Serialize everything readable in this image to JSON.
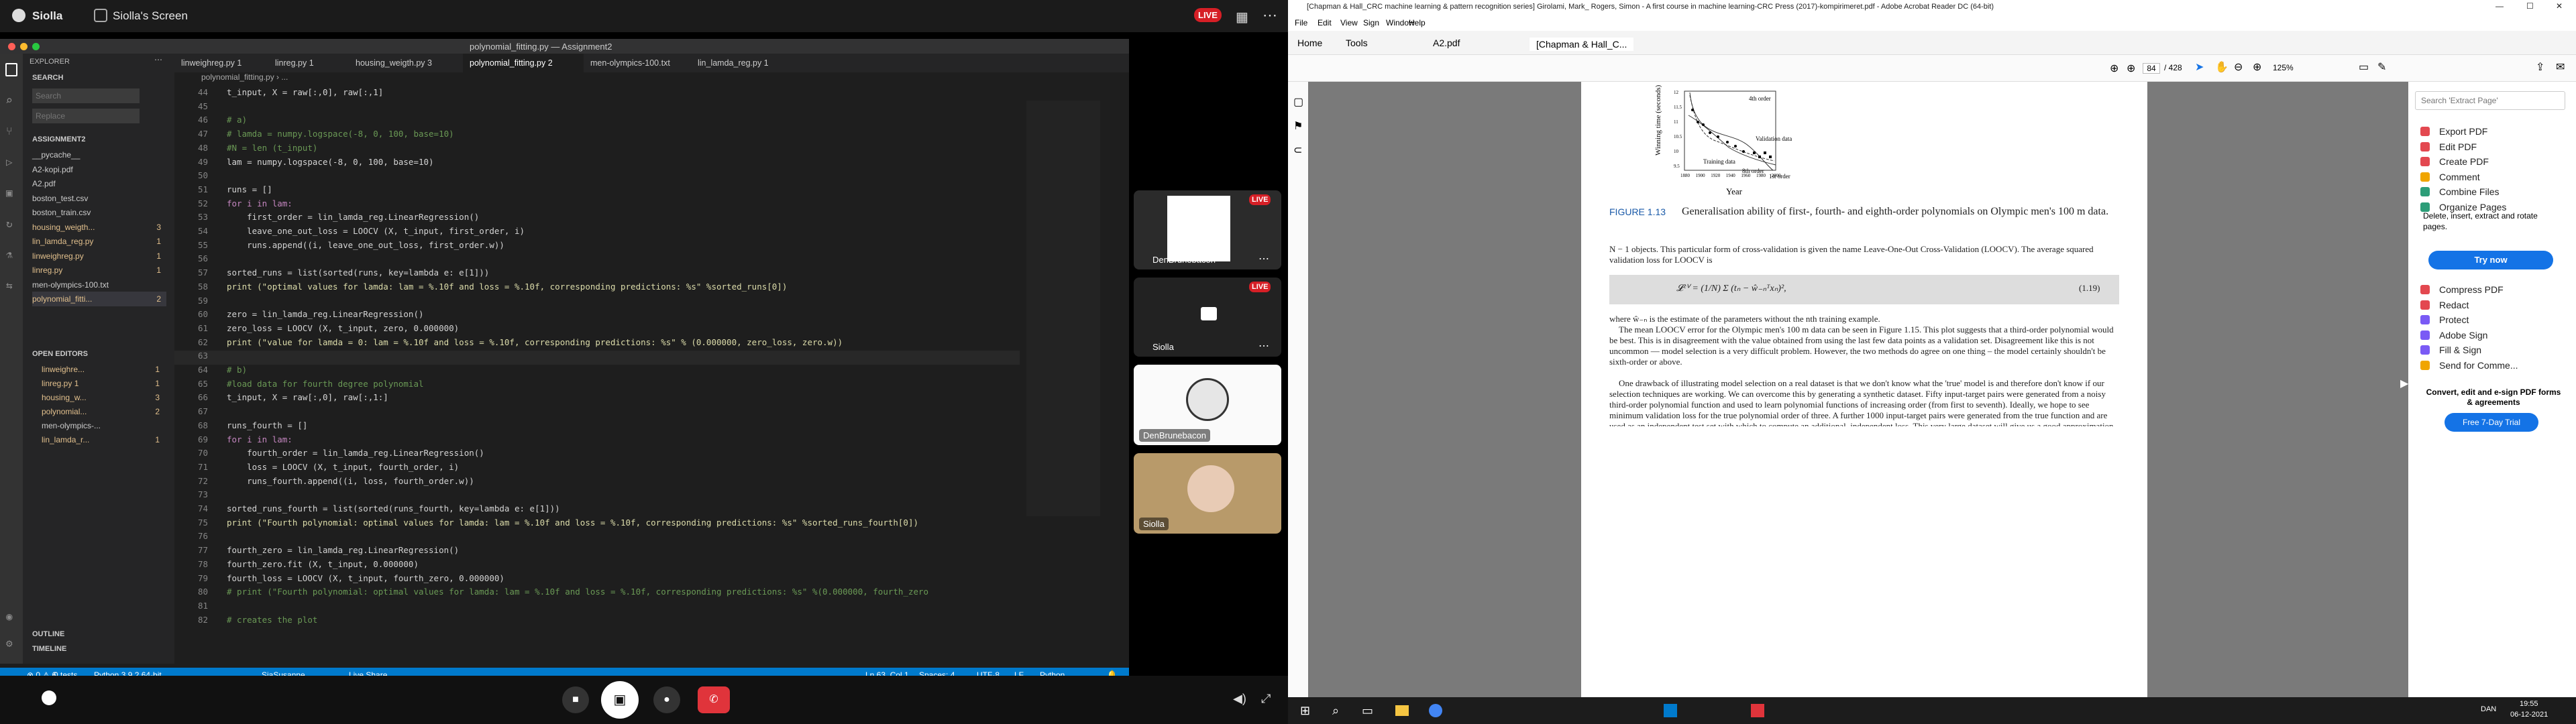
{
  "share": {
    "name": "Siolla",
    "screen": "Siolla's Screen",
    "live": "LIVE"
  },
  "vscode": {
    "title": "polynomial_fitting.py — Assignment2",
    "tabs": [
      {
        "label": "linweighreg.py 1"
      },
      {
        "label": "linreg.py 1"
      },
      {
        "label": "housing_weigth.py 3"
      },
      {
        "label": "polynomial_fitting.py 2"
      },
      {
        "label": "men-olympics-100.txt"
      },
      {
        "label": "lin_lamda_reg.py 1"
      }
    ],
    "breadcrumb": "polynomial_fitting.py › ...",
    "explorer": {
      "title": "EXPLORER",
      "search_title": "SEARCH",
      "search_placeholder": "Search",
      "replace_placeholder": "Replace",
      "folder": "ASSIGNMENT2",
      "files": [
        {
          "name": "__pycache__",
          "badge": ""
        },
        {
          "name": "A2-kopi.pdf",
          "badge": ""
        },
        {
          "name": "A2.pdf",
          "badge": ""
        },
        {
          "name": "boston_test.csv",
          "badge": ""
        },
        {
          "name": "boston_train.csv",
          "badge": ""
        },
        {
          "name": "housing_weigth...",
          "badge": "3"
        },
        {
          "name": "lin_lamda_reg.py",
          "badge": "1"
        },
        {
          "name": "linweighreg.py",
          "badge": "1"
        },
        {
          "name": "linreg.py",
          "badge": "1"
        },
        {
          "name": "men-olympics-100.txt",
          "badge": ""
        },
        {
          "name": "polynomial_fitti...",
          "badge": "2"
        }
      ],
      "open_editors_title": "OPEN EDITORS",
      "open_editors": [
        {
          "name": "linweighre...",
          "badge": "1"
        },
        {
          "name": "linreg.py 1",
          "badge": "1"
        },
        {
          "name": "housing_w...",
          "badge": "3"
        },
        {
          "name": "polynomial...",
          "badge": "2"
        },
        {
          "name": "men-olympics-...",
          "badge": ""
        },
        {
          "name": "lin_lamda_r...",
          "badge": "1"
        }
      ],
      "outline": "OUTLINE",
      "timeline": "TIMELINE"
    },
    "code": [
      {
        "n": "44",
        "t": "t_input, X = raw[:,0], raw[:,1]"
      },
      {
        "n": "45",
        "t": ""
      },
      {
        "n": "46",
        "t": "# a)"
      },
      {
        "n": "47",
        "t": "# lamda = numpy.logspace(-8, 0, 100, base=10)"
      },
      {
        "n": "48",
        "t": "#N = len (t_input)"
      },
      {
        "n": "49",
        "t": "lam = numpy.logspace(-8, 0, 100, base=10)"
      },
      {
        "n": "50",
        "t": ""
      },
      {
        "n": "51",
        "t": "runs = []"
      },
      {
        "n": "52",
        "t": "for i in lam:"
      },
      {
        "n": "53",
        "t": "    first_order = lin_lamda_reg.LinearRegression()"
      },
      {
        "n": "54",
        "t": "    leave_one_out_loss = LOOCV (X, t_input, first_order, i)"
      },
      {
        "n": "55",
        "t": "    runs.append((i, leave_one_out_loss, first_order.w))"
      },
      {
        "n": "56",
        "t": ""
      },
      {
        "n": "57",
        "t": "sorted_runs = list(sorted(runs, key=lambda e: e[1]))"
      },
      {
        "n": "58",
        "t": "print (\"optimal values for lamda: lam = %.10f and loss = %.10f, corresponding predictions: %s\" %sorted_runs[0])"
      },
      {
        "n": "59",
        "t": ""
      },
      {
        "n": "60",
        "t": "zero = lin_lamda_reg.LinearRegression()"
      },
      {
        "n": "61",
        "t": "zero_loss = LOOCV (X, t_input, zero, 0.000000)"
      },
      {
        "n": "62",
        "t": "print (\"value for lamda = 0: lam = %.10f and loss = %.10f, corresponding predictions: %s\" % (0.000000, zero_loss, zero.w))"
      },
      {
        "n": "63",
        "t": ""
      },
      {
        "n": "64",
        "t": "# b)"
      },
      {
        "n": "65",
        "t": "#load data for fourth degree polynomial"
      },
      {
        "n": "66",
        "t": "t_input, X = raw[:,0], raw[:,1:]"
      },
      {
        "n": "67",
        "t": ""
      },
      {
        "n": "68",
        "t": "runs_fourth = []"
      },
      {
        "n": "69",
        "t": "for i in lam:"
      },
      {
        "n": "70",
        "t": "    fourth_order = lin_lamda_reg.LinearRegression()"
      },
      {
        "n": "71",
        "t": "    loss = LOOCV (X, t_input, fourth_order, i)"
      },
      {
        "n": "72",
        "t": "    runs_fourth.append((i, loss, fourth_order.w))"
      },
      {
        "n": "73",
        "t": ""
      },
      {
        "n": "74",
        "t": "sorted_runs_fourth = list(sorted(runs_fourth, key=lambda e: e[1]))"
      },
      {
        "n": "75",
        "t": "print (\"Fourth polynomial: optimal values for lamda: lam = %.10f and loss = %.10f, corresponding predictions: %s\" %sorted_runs_fourth[0])"
      },
      {
        "n": "76",
        "t": ""
      },
      {
        "n": "77",
        "t": "fourth_zero = lin_lamda_reg.LinearRegression()"
      },
      {
        "n": "78",
        "t": "fourth_zero.fit (X, t_input, 0.000000)"
      },
      {
        "n": "79",
        "t": "fourth_loss = LOOCV (X, t_input, fourth_zero, 0.000000)"
      },
      {
        "n": "80",
        "t": "# print (\"Fourth polynomial: optimal values for lamda: lam = %.10f and loss = %.10f, corresponding predictions: %s\" %(0.000000, fourth_zero"
      },
      {
        "n": "81",
        "t": ""
      },
      {
        "n": "82",
        "t": "# creates the plot"
      }
    ],
    "status": {
      "errors": "⊗ 0 ⚠ 6",
      "tests": "0 tests",
      "python": "Python 3.9.2 64-bit",
      "live": "SiaSusanne",
      "liveshare": "Live Share",
      "pos": "Ln 63, Col 1",
      "spaces": "Spaces: 4",
      "enc": "UTF-8",
      "eol": "LF",
      "lang": "Python"
    }
  },
  "participants": [
    {
      "name": "DenBrunebacon",
      "live": "LIVE"
    },
    {
      "name": "Siolla",
      "live": "LIVE"
    },
    {
      "name": "DenBrunebacon"
    },
    {
      "name": "Siolla"
    }
  ],
  "acrobat": {
    "title": "[Chapman & Hall_CRC machine learning & pattern recognition series] Girolami, Mark_ Rogers, Simon - A first course in machine learning-CRC Press (2017)-kompirimeret.pdf - Adobe Acrobat Reader DC (64-bit)",
    "menu": [
      "File",
      "Edit",
      "View",
      "Sign",
      "Window",
      "Help"
    ],
    "tabs": [
      "Home",
      "Tools",
      "A2.pdf",
      "[Chapman & Hall_C..."
    ],
    "page_num": "84",
    "page_total": "/ 428",
    "zoom": "125%",
    "search_placeholder": "Search 'Extract Page'",
    "tools": [
      {
        "label": "Export PDF",
        "color": "#e34850"
      },
      {
        "label": "Edit PDF",
        "color": "#e34850"
      },
      {
        "label": "Create PDF",
        "color": "#e34850"
      },
      {
        "label": "Comment",
        "color": "#f0a500"
      },
      {
        "label": "Combine Files",
        "color": "#2d9d78"
      },
      {
        "label": "Organize Pages",
        "color": "#2d9d78"
      }
    ],
    "organize_desc": "Delete, insert, extract and rotate pages.",
    "try_now": "Try now",
    "tools2": [
      {
        "label": "Compress PDF",
        "color": "#e34850"
      },
      {
        "label": "Redact",
        "color": "#e34850"
      },
      {
        "label": "Protect",
        "color": "#7a5af5"
      },
      {
        "label": "Adobe Sign",
        "color": "#7a5af5"
      },
      {
        "label": "Fill & Sign",
        "color": "#7a5af5"
      },
      {
        "label": "Send for Comme...",
        "color": "#f0a500"
      }
    ],
    "promo": "Convert, edit and e-sign PDF forms & agreements",
    "trial": "Free 7-Day Trial",
    "fig": {
      "ylabel": "Winning time (seconds)",
      "xlabel": "Year",
      "labels": {
        "fourth": "4th order",
        "validation": "Validation data",
        "training": "Training data",
        "eighth": "8th order",
        "first": "1st order"
      },
      "yticks": [
        "12",
        "11.5",
        "11",
        "10.5",
        "10",
        "9.5"
      ],
      "xticks": [
        "1880",
        "1900",
        "1920",
        "1940",
        "1960",
        "1980",
        "2000"
      ]
    },
    "caption_num": "FIGURE 1.13",
    "caption": "Generalisation ability of first-, fourth- and eighth-order polynomials on Olympic men's 100 m data.",
    "p1": "N − 1 objects. This particular form of cross-validation is given the name Leave-One-Out Cross-Validation (LOOCV). The average squared validation loss for LOOCV is",
    "eq_num": "(1.19)",
    "p2": "where ŵ₋ₙ is the estimate of the parameters without the nth training example.",
    "p3": "The mean LOOCV error for the Olympic men's 100 m data can be seen in Figure 1.15. This plot suggests that a third-order polynomial would be best. This is in disagreement with the value obtained from using the last few data points as a validation set. Disagreement like this is not uncommon — model selection is a very difficult problem. However, the two methods do agree on one thing – the model certainly shouldn't be sixth-order or above.",
    "p4": "One drawback of illustrating model selection on a real dataset is that we don't know what the 'true' model is and therefore don't know if our selection techniques are working. We can overcome this by generating a synthetic dataset. Fifty input-target pairs were generated from a noisy third-order polynomial function and used to learn polynomial functions of increasing order (from first to seventh). Ideally, we hope to see minimum validation loss for the true polynomial order of three. A further 1000 input-target pairs were generated from the true function and are used as an independent test set with which to compute an additional, independent loss. This very large dataset will give us a good approximation to the true expected loss"
  },
  "taskbar": {
    "time": "19:55",
    "date": "06-12-2021",
    "lang": "DAN"
  }
}
